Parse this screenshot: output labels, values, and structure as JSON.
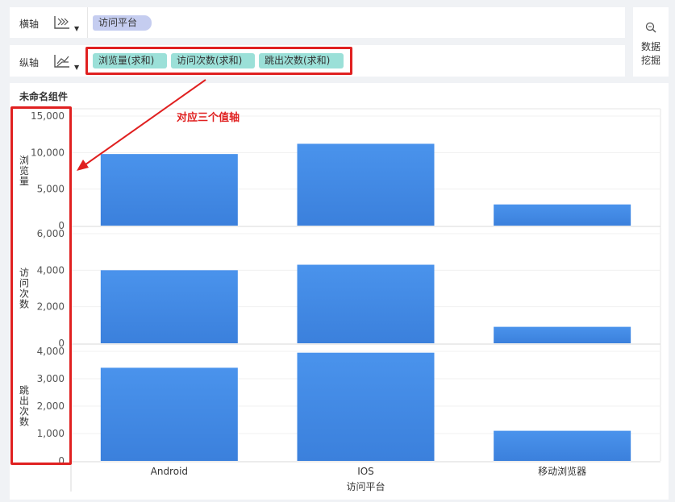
{
  "shelf": {
    "x_label": "横轴",
    "y_label": "纵轴",
    "x_pills": [
      "访问平台"
    ],
    "y_pills": [
      "浏览量(求和)",
      "访问次数(求和)",
      "跳出次数(求和)"
    ],
    "mining_line1": "数据",
    "mining_line2": "挖掘"
  },
  "component_title": "未命名组件",
  "annotation": "对应三个值轴",
  "chart_data": {
    "type": "bar",
    "categories": [
      "Android",
      "IOS",
      "移动浏览器"
    ],
    "xlabel": "访问平台",
    "series": [
      {
        "name": "浏览量",
        "values": [
          9800,
          11200,
          2900
        ],
        "ylim": [
          0,
          15000
        ],
        "ticks": [
          "0",
          "5,000",
          "10,000",
          "15,000"
        ]
      },
      {
        "name": "访问次数",
        "values": [
          4000,
          4300,
          900
        ],
        "ylim": [
          0,
          6000
        ],
        "ticks": [
          "0",
          "2,000",
          "4,000",
          "6,000"
        ]
      },
      {
        "name": "跳出次数",
        "values": [
          3400,
          3950,
          1100
        ],
        "ylim": [
          0,
          4000
        ],
        "ticks": [
          "0",
          "1,000",
          "2,000",
          "3,000",
          "4,000"
        ]
      }
    ],
    "bar_color": "#4a90e8",
    "grid": true
  }
}
